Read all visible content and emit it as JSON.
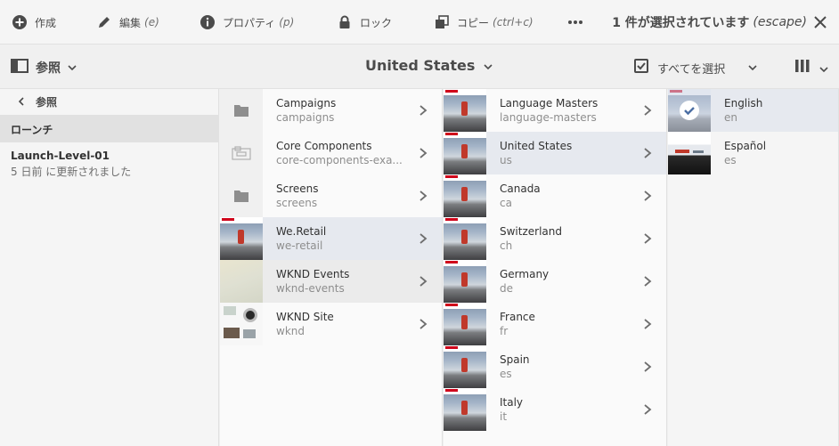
{
  "actionbar": {
    "create": {
      "label": "作成"
    },
    "edit": {
      "label": "編集",
      "hint": "(e)"
    },
    "properties": {
      "label": "プロパティ",
      "hint": "(p)"
    },
    "lock": {
      "label": "ロック"
    },
    "copy": {
      "label": "コピー",
      "hint": "(ctrl+c)"
    },
    "selection": {
      "label": "1 件が選択されています",
      "hint": "(escape)"
    }
  },
  "toolbar": {
    "rail_label": "参照",
    "title": "United States",
    "select_all": "すべてを選択"
  },
  "rail": {
    "back_label": "参照",
    "section": "ローンチ",
    "item": {
      "name": "Launch-Level-01",
      "meta": "5 日前 に更新されました"
    }
  },
  "columns": [
    {
      "items": [
        {
          "title": "Campaigns",
          "subtitle": "campaigns",
          "thumb": "folder-icon"
        },
        {
          "title": "Core Components",
          "subtitle": "core-components-exa...",
          "thumb": "component-icon"
        },
        {
          "title": "Screens",
          "subtitle": "screens",
          "thumb": "folder-icon"
        },
        {
          "title": "We.Retail",
          "subtitle": "we-retail",
          "thumb": "image"
        },
        {
          "title": "WKND Events",
          "subtitle": "wknd-events",
          "thumb": "image"
        },
        {
          "title": "WKND Site",
          "subtitle": "wknd",
          "thumb": "image"
        }
      ]
    },
    {
      "items": [
        {
          "title": "Language Masters",
          "subtitle": "language-masters"
        },
        {
          "title": "United States",
          "subtitle": "us"
        },
        {
          "title": "Canada",
          "subtitle": "ca"
        },
        {
          "title": "Switzerland",
          "subtitle": "ch"
        },
        {
          "title": "Germany",
          "subtitle": "de"
        },
        {
          "title": "France",
          "subtitle": "fr"
        },
        {
          "title": "Spain",
          "subtitle": "es"
        },
        {
          "title": "Italy",
          "subtitle": "it"
        }
      ]
    },
    {
      "items": [
        {
          "title": "English",
          "subtitle": "en"
        },
        {
          "title": "Español",
          "subtitle": "es"
        }
      ]
    }
  ],
  "colors": {
    "accent": "#2680eb",
    "active_row": "#e6e9ef",
    "text": "#323232",
    "muted": "#8e8e8e"
  }
}
